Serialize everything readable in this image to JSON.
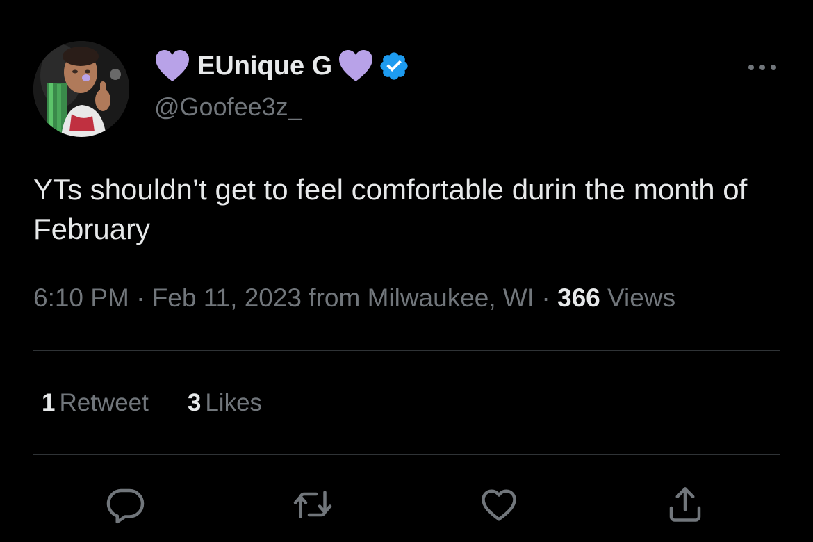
{
  "user": {
    "display_name": "EUnique G",
    "handle": "@Goofee3z_",
    "verified": true,
    "name_emoji": "purple-heart-icon",
    "emoji_color": "#b8a2e8",
    "badge_color": "#1d9bf0"
  },
  "tweet": {
    "text": "YTs shouldn’t get to feel comfortable durin the month of February"
  },
  "meta": {
    "time": "6:10 PM",
    "separator": "·",
    "date": "Feb 11, 2023",
    "location": "from Milwaukee, WI",
    "views_count": "366",
    "views_label": "Views"
  },
  "stats": {
    "retweets_count": "1",
    "retweets_label": "Retweet",
    "likes_count": "3",
    "likes_label": "Likes"
  },
  "actions": [
    {
      "name": "reply",
      "icon": "reply-icon"
    },
    {
      "name": "retweet",
      "icon": "retweet-icon"
    },
    {
      "name": "like",
      "icon": "heart-outline-icon"
    },
    {
      "name": "share",
      "icon": "share-icon"
    }
  ],
  "colors": {
    "background": "#000000",
    "text_primary": "#e7e9ea",
    "text_secondary": "#71767b",
    "divider": "#2f3336"
  }
}
